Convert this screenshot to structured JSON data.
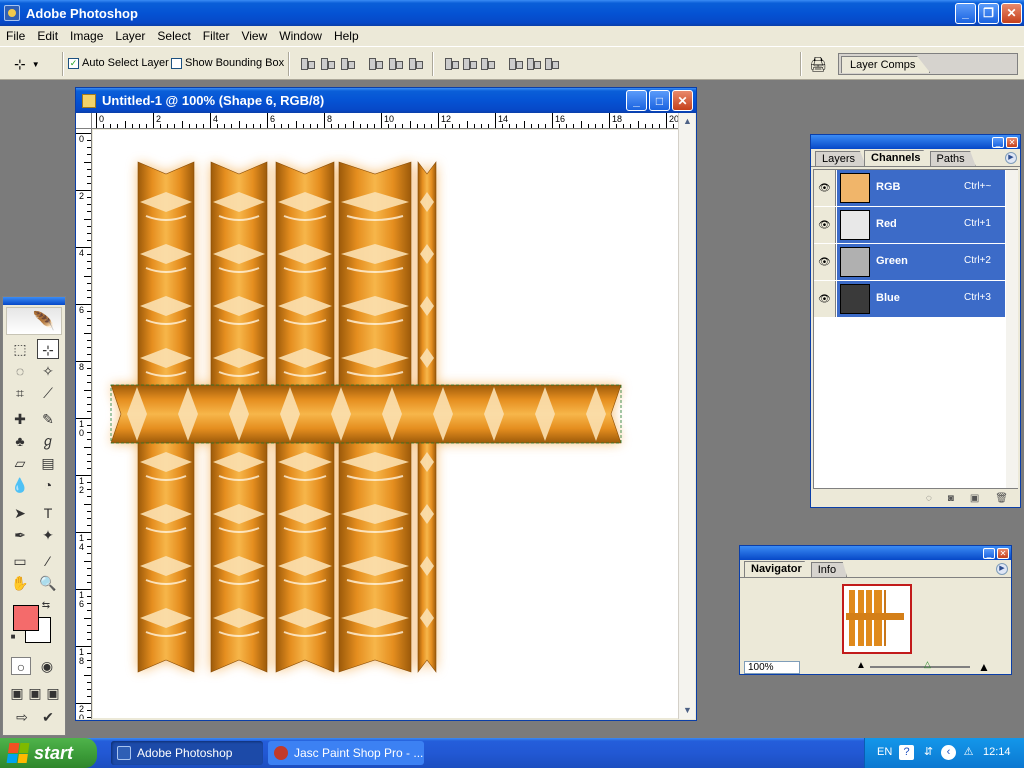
{
  "app": {
    "title": "Adobe Photoshop"
  },
  "menu": [
    "File",
    "Edit",
    "Image",
    "Layer",
    "Select",
    "Filter",
    "View",
    "Window",
    "Help"
  ],
  "options": {
    "auto_select_label": "Auto Select Layer",
    "auto_select_checked": true,
    "show_bounding_box_label": "Show Bounding Box",
    "show_bounding_box_checked": false,
    "palette_well_tab": "Layer Comps"
  },
  "document": {
    "title": "Untitled-1 @ 100% (Shape 6, RGB/8)",
    "ruler_h": [
      "0",
      "2",
      "4",
      "6",
      "8",
      "10",
      "12",
      "14",
      "16",
      "18",
      "20"
    ],
    "ruler_v": [
      "0",
      "2",
      "4",
      "6",
      "8",
      "10",
      "12",
      "14",
      "16",
      "18",
      "20"
    ]
  },
  "channels_panel": {
    "tabs": [
      "Layers",
      "Channels",
      "Paths"
    ],
    "active_tab": "Channels",
    "channels": [
      {
        "name": "RGB",
        "shortcut": "Ctrl+~"
      },
      {
        "name": "Red",
        "shortcut": "Ctrl+1"
      },
      {
        "name": "Green",
        "shortcut": "Ctrl+2"
      },
      {
        "name": "Blue",
        "shortcut": "Ctrl+3"
      }
    ]
  },
  "navigator_panel": {
    "tabs": [
      "Navigator",
      "Info"
    ],
    "active_tab": "Navigator",
    "zoom": "100%"
  },
  "colors": {
    "foreground": "#f46b6b",
    "background": "#ffffff",
    "shape_fill": "#e08a1c"
  },
  "taskbar": {
    "start_label": "start",
    "tasks": [
      "Adobe Photoshop",
      "Jasc Paint Shop Pro - ..."
    ],
    "tray_lang": "EN",
    "clock": "12:14"
  }
}
